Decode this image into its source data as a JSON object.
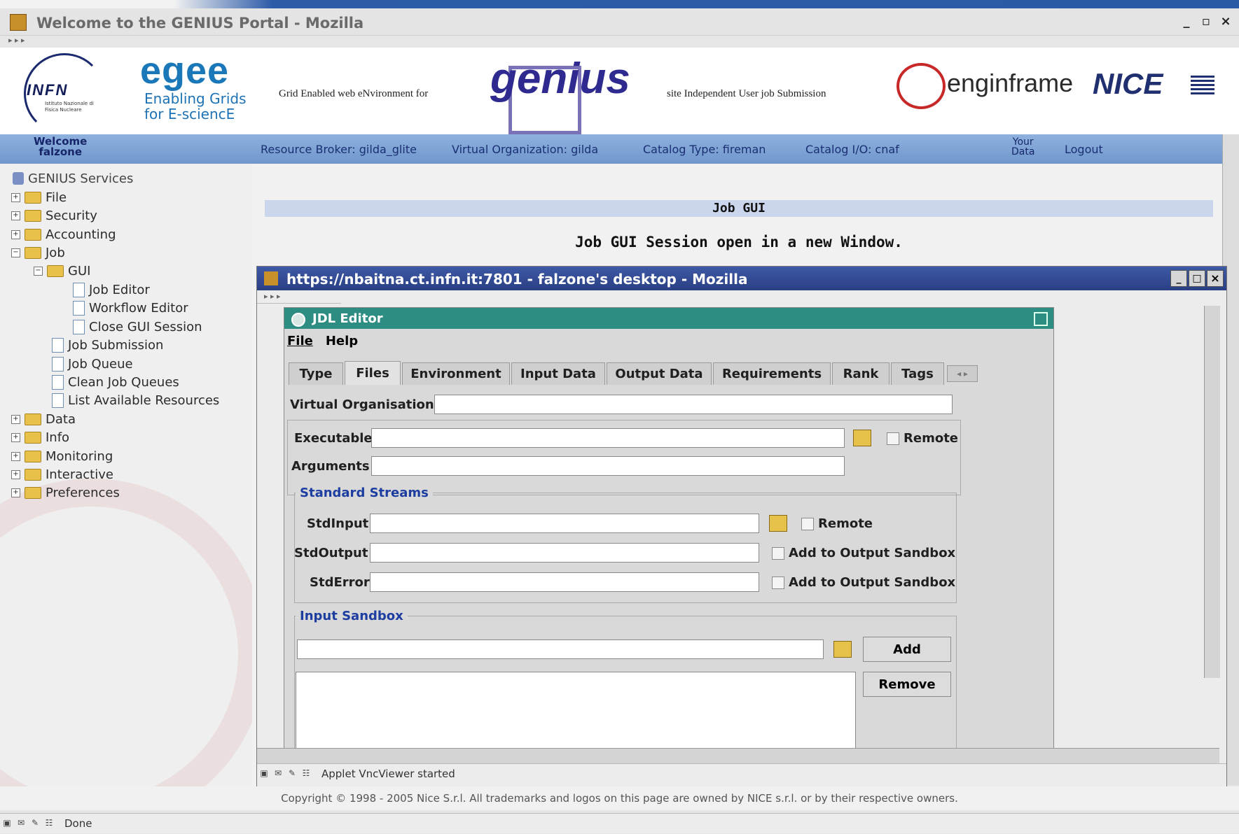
{
  "window": {
    "title": "Welcome to the GENIUS Portal - Mozilla",
    "controls": [
      "_",
      "▫",
      "×"
    ],
    "nav": "▸ ▸ ▸"
  },
  "banner": {
    "infn": "INFN",
    "infn_sub": "Istituto Nazionale di Fisica Nucleare",
    "egee": "egee",
    "egee_line1": "Enabling Grids",
    "egee_line2": "for E-sciencE",
    "grid_text": "Grid Enabled web eNvironment for",
    "genius": "genius",
    "site_text": "site Independent User job Submission",
    "enginframe": "enginframe",
    "nice": "NICE"
  },
  "bluebar": {
    "welcome": "Welcome",
    "user": "falzone",
    "resource_broker": "Resource Broker: gilda_glite",
    "vo": "Virtual Organization: gilda",
    "catalog_type": "Catalog Type: fireman",
    "catalog_io": "Catalog I/O: cnaf",
    "your": "Your",
    "data": "Data",
    "logout": "Logout"
  },
  "sidebar": {
    "root": "GENIUS Services",
    "items": [
      {
        "label": "File"
      },
      {
        "label": "Security"
      },
      {
        "label": "Accounting"
      },
      {
        "label": "Job"
      },
      {
        "label": "GUI"
      },
      {
        "label": "Job Editor"
      },
      {
        "label": "Workflow Editor"
      },
      {
        "label": "Close GUI Session"
      },
      {
        "label": "Job Submission"
      },
      {
        "label": "Job Queue"
      },
      {
        "label": "Clean Job Queues"
      },
      {
        "label": "List Available Resources"
      },
      {
        "label": "Data"
      },
      {
        "label": "Info"
      },
      {
        "label": "Monitoring"
      },
      {
        "label": "Interactive"
      },
      {
        "label": "Preferences"
      }
    ]
  },
  "main": {
    "heading": "Job GUI",
    "message": "Job GUI Session open in a new Window."
  },
  "inner_window": {
    "title": "https://nbaitna.ct.infn.it:7801 - falzone's desktop - Mozilla",
    "status": "Applet VncViewer started"
  },
  "jdl": {
    "title": "JDL Editor",
    "menu": [
      "File",
      "Help"
    ],
    "tabs": [
      "Type",
      "Files",
      "Environment",
      "Input Data",
      "Output Data",
      "Requirements",
      "Rank",
      "Tags"
    ],
    "vo_label": "Virtual Organisation",
    "executable_label": "Executable",
    "remote": "Remote",
    "arguments_label": "Arguments",
    "std_streams": "Standard Streams",
    "stdinput": "StdInput",
    "stdoutput": "StdOutput",
    "stderror": "StdError",
    "add_to_sandbox": "Add to Output Sandbox",
    "input_sandbox": "Input Sandbox",
    "add": "Add",
    "remove": "Remove"
  },
  "footer": {
    "copyright": "Copyright © 1998 - 2005 Nice S.r.l. All trademarks and logos on this page are owned by NICE s.r.l. or by their respective owners.",
    "status": "Done"
  }
}
